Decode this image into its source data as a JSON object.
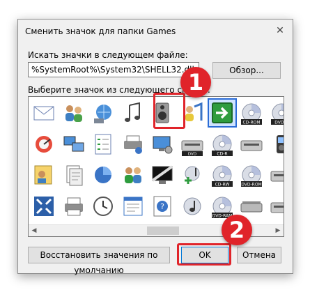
{
  "dialog": {
    "title": "Сменить значок для папки Games",
    "close_glyph": "✕",
    "file_label": "Искать значки в следующем файле:",
    "file_path": "%SystemRoot%\\System32\\SHELL32.dll",
    "browse_label": "Обзор...",
    "list_label": "Выберите значок из следующего списка:",
    "restore_label": "Восстановить значения по умолчанию",
    "ok_label": "OK",
    "cancel_label": "Отмена",
    "selected_icon": "green-arrow-icon"
  },
  "icons": [
    "envelope-icon",
    "users-icon",
    "network-globe-icon",
    "music-notes-icon",
    "speaker-icon",
    "network-user-icon",
    "green-arrow-icon",
    "cd-rom-icon",
    "dvd-r-icon",
    "disc-icon",
    "media-player-icon",
    "defrag-icon",
    "computers-network-icon",
    "checklist-icon",
    "printer-settings-icon",
    "pc-settings-icon",
    "dvd-drive-icon",
    "cd-r-icon",
    "cd-drive-icon",
    "mp3-player-icon",
    "gallery-icon",
    "card-reader-icon",
    "user-card-icon",
    "documents-icon",
    "pie-chart-icon",
    "users-group-icon",
    "display-icon",
    "music-add-icon",
    "cd-rw-icon",
    "dvd-rom-icon",
    "drive-icon",
    "dvd-rom-disc-icon",
    "phone-icon",
    "fullscreen-icon",
    "printer-icon",
    "clock-icon",
    "window-list-icon",
    "help-icon",
    "music-disc-icon",
    "dvd-ram-icon",
    "scanner-icon",
    "dvd-ram-drive-icon",
    "camera-icon",
    "camera-settings-icon"
  ],
  "annotations": {
    "badge1": "1",
    "badge2": "2",
    "color": "#e0242a"
  }
}
